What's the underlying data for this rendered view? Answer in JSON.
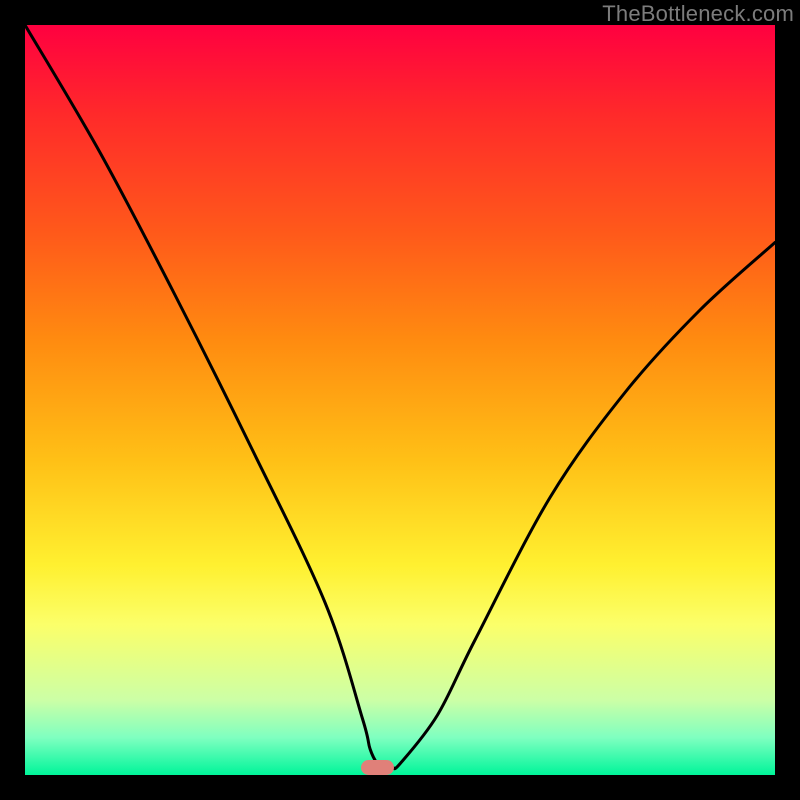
{
  "watermark": "TheBottleneck.com",
  "chart_data": {
    "type": "line",
    "title": "",
    "xlabel": "",
    "ylabel": "",
    "xlim": [
      0,
      100
    ],
    "ylim": [
      0,
      100
    ],
    "grid": false,
    "legend": false,
    "series": [
      {
        "name": "bottleneck-curve",
        "x": [
          0,
          10,
          20,
          30,
          40,
          45,
          46,
          47,
          48,
          49,
          50,
          55,
          60,
          70,
          80,
          90,
          100
        ],
        "values": [
          100,
          83,
          64,
          44,
          23,
          7.5,
          3.5,
          1.5,
          1,
          1,
          1.5,
          8,
          18,
          37,
          51,
          62,
          71
        ]
      }
    ],
    "annotations": [
      {
        "name": "optimal-marker",
        "shape": "pill",
        "x_center": 47,
        "y_center": 1,
        "width_pct": 4.5,
        "height_pct": 2.0,
        "color": "#e08079"
      }
    ],
    "gradient_meaning": "poor-to-good (red→green, top→bottom)"
  }
}
